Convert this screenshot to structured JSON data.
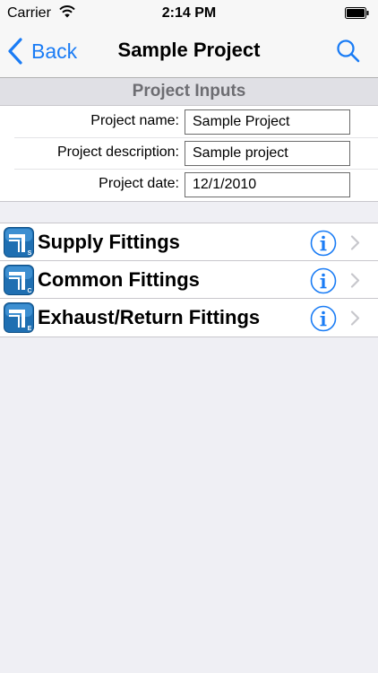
{
  "status_bar": {
    "carrier": "Carrier",
    "time": "2:14 PM"
  },
  "nav": {
    "back_label": "Back",
    "title": "Sample Project",
    "accent_color": "#1a7cf5"
  },
  "project_inputs": {
    "header": "Project Inputs",
    "fields": [
      {
        "label": "Project name:",
        "value": "Sample Project"
      },
      {
        "label": "Project description:",
        "value": "Sample project"
      },
      {
        "label": "Project date:",
        "value": "12/1/2010"
      }
    ]
  },
  "fittings": {
    "items": [
      {
        "label": "Supply Fittings",
        "badge": "S"
      },
      {
        "label": "Common Fittings",
        "badge": "C"
      },
      {
        "label": "Exhaust/Return Fittings",
        "badge": "E"
      }
    ]
  },
  "icons": {
    "signal": "wifi-icon",
    "battery": "battery-icon",
    "back": "chevron-left-icon",
    "search": "search-icon",
    "info": "info-icon",
    "disclosure": "chevron-right-icon",
    "fitting": "fitting-app-icon"
  }
}
